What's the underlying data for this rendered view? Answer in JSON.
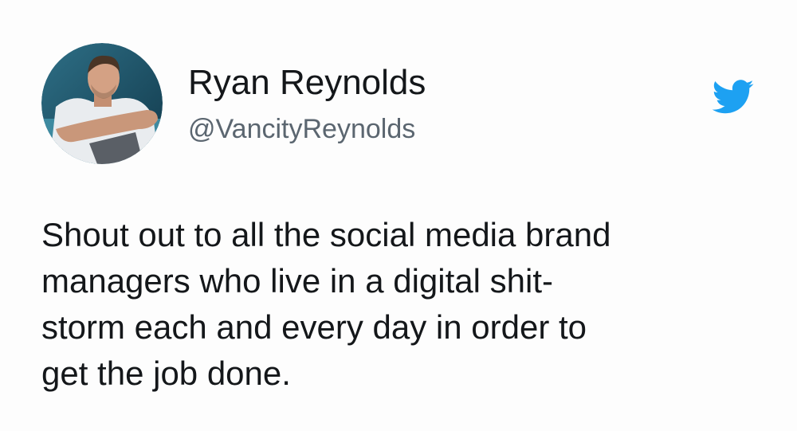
{
  "user": {
    "display_name": "Ryan Reynolds",
    "handle": "@VancityReynolds",
    "avatar_icon": "profile-photo"
  },
  "brand_icon": "twitter-bird-icon",
  "colors": {
    "brand_blue": "#1da1f2",
    "text_primary": "#14171a",
    "text_secondary": "#5b6670"
  },
  "tweet": {
    "lines": [
      "Shout out to all the social media brand",
      "managers who live in a digital shit-",
      "storm each and every day in order to",
      "get the job done."
    ]
  }
}
